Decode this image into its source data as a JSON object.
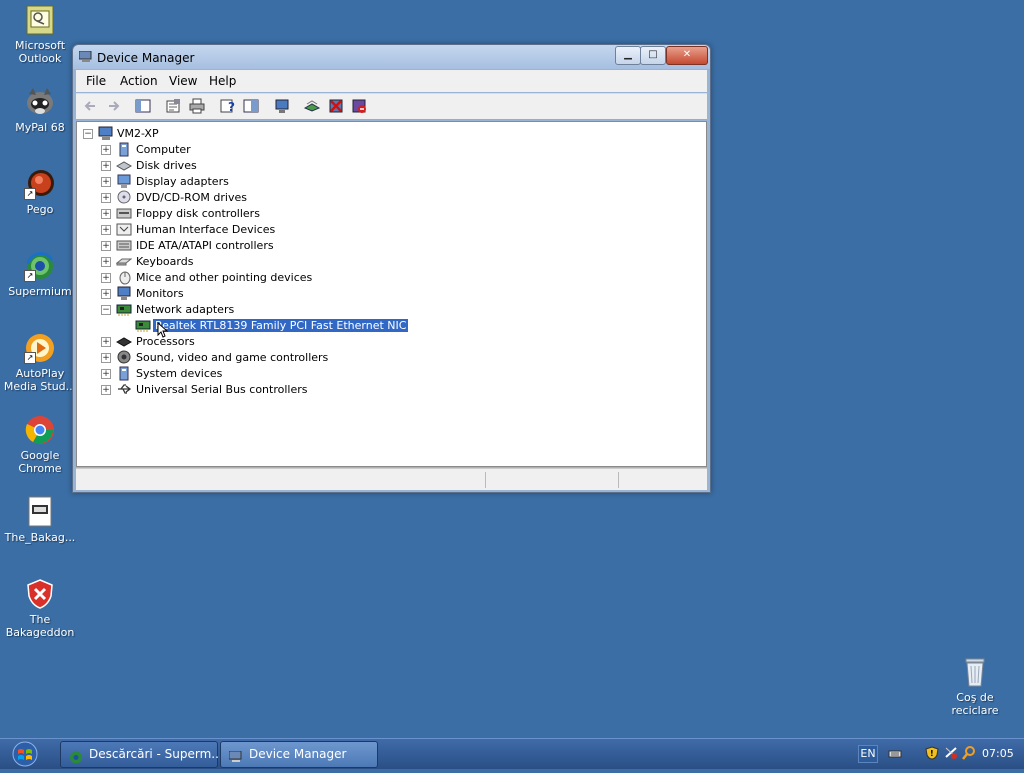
{
  "desktop": {
    "icons": [
      {
        "label": "Microsoft Outlook",
        "icon": "outlook-icon"
      },
      {
        "label": "MyPal 68",
        "icon": "mypal-raccoon-icon"
      },
      {
        "label": "Pego",
        "icon": "pego-icon"
      },
      {
        "label": "Supermium",
        "icon": "supermium-icon"
      },
      {
        "label": "AutoPlay Media Stud...",
        "icon": "autoplay-icon"
      },
      {
        "label": "Google Chrome",
        "icon": "chrome-icon"
      },
      {
        "label": "The_Bakag...",
        "icon": "document-icon"
      },
      {
        "label": "The Bakageddon",
        "icon": "shield-x-icon"
      },
      {
        "label": "Coş de reciclare",
        "icon": "recycle-bin-icon"
      }
    ]
  },
  "window": {
    "title": "Device Manager",
    "controls": {
      "minimize": "▁",
      "maximize": "□",
      "close": "✕"
    },
    "menu": [
      "File",
      "Action",
      "View",
      "Help"
    ],
    "toolbar": [
      "back-arrow-icon",
      "forward-arrow-icon",
      "show-hide-tree-icon",
      "properties-icon",
      "print-icon",
      "help-icon",
      "details-pane-icon",
      "scan-hardware-icon",
      "update-driver-icon",
      "uninstall-icon",
      "disable-icon"
    ],
    "tree": {
      "root": "VM2-XP",
      "items": [
        {
          "label": "Computer",
          "expanded": false
        },
        {
          "label": "Disk drives",
          "expanded": false
        },
        {
          "label": "Display adapters",
          "expanded": false
        },
        {
          "label": "DVD/CD-ROM drives",
          "expanded": false
        },
        {
          "label": "Floppy disk controllers",
          "expanded": false
        },
        {
          "label": "Human Interface Devices",
          "expanded": false
        },
        {
          "label": "IDE ATA/ATAPI controllers",
          "expanded": false
        },
        {
          "label": "Keyboards",
          "expanded": false
        },
        {
          "label": "Mice and other pointing devices",
          "expanded": false
        },
        {
          "label": "Monitors",
          "expanded": false
        },
        {
          "label": "Network adapters",
          "expanded": true
        },
        {
          "label": "Realtek RTL8139 Family PCI Fast Ethernet NIC",
          "child": true,
          "selected": true
        },
        {
          "label": "Processors",
          "expanded": false
        },
        {
          "label": "Sound, video and game controllers",
          "expanded": false
        },
        {
          "label": "System devices",
          "expanded": false
        },
        {
          "label": "Universal Serial Bus controllers",
          "expanded": false
        }
      ]
    }
  },
  "taskbar": {
    "tasks": [
      {
        "label": "Descărcări - Superm...",
        "active": false
      },
      {
        "label": "Device Manager",
        "active": true
      }
    ],
    "language": "EN",
    "clock": "07:05"
  },
  "colors": {
    "desktop": "#3a6ea5",
    "selection": "#3168c6"
  }
}
